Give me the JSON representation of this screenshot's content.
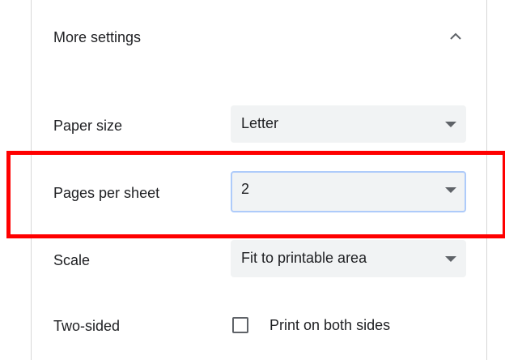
{
  "more_settings": {
    "label": "More settings",
    "expanded_icon": "chevron-up-icon"
  },
  "paper_size": {
    "label": "Paper size",
    "value": "Letter"
  },
  "pages_per_sheet": {
    "label": "Pages per sheet",
    "value": "2"
  },
  "scale": {
    "label": "Scale",
    "value": "Fit to printable area"
  },
  "two_sided": {
    "label": "Two-sided",
    "checkbox_label": "Print on both sides",
    "checked": false
  },
  "colors": {
    "highlight": "#ff0000",
    "focus_border": "#aecbfa",
    "select_bg": "#f1f3f4",
    "text": "#202124"
  }
}
